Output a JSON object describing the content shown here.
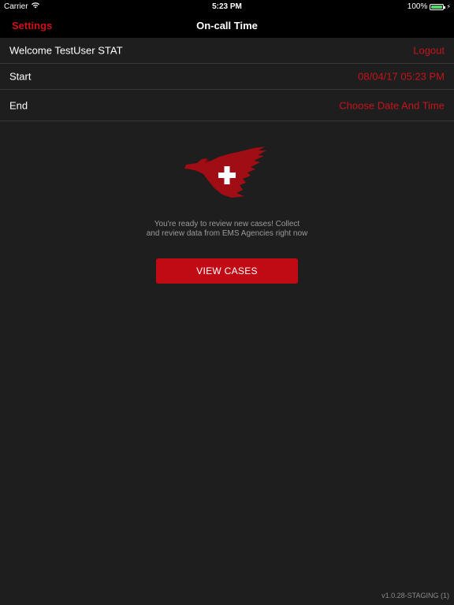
{
  "status_bar": {
    "carrier": "Carrier",
    "time": "5:23 PM",
    "battery_percent": "100%",
    "battery_level": 1.0,
    "wifi_icon": "wifi-icon",
    "battery_icon": "battery-icon",
    "charging_icon": "charging-bolt-icon"
  },
  "nav": {
    "settings_label": "Settings",
    "title": "On-call Time"
  },
  "rows": {
    "welcome": {
      "label": "Welcome TestUser STAT",
      "action": "Logout"
    },
    "start": {
      "label": "Start",
      "value": "08/04/17 05:23 PM"
    },
    "end": {
      "label": "End",
      "value": "Choose Date And Time"
    }
  },
  "main": {
    "logo_icon": "eagle-cross-logo",
    "message_line1": "You're ready to review new cases! Collect",
    "message_line2": "and review data from EMS Agencies right now",
    "view_cases_label": "VIEW CASES"
  },
  "footer": {
    "version": "v1.0.28-STAGING (1)"
  },
  "colors": {
    "accent": "#c4141c",
    "background": "#1e1e1e",
    "bar_background": "#000000",
    "battery_green": "#4cd964"
  }
}
